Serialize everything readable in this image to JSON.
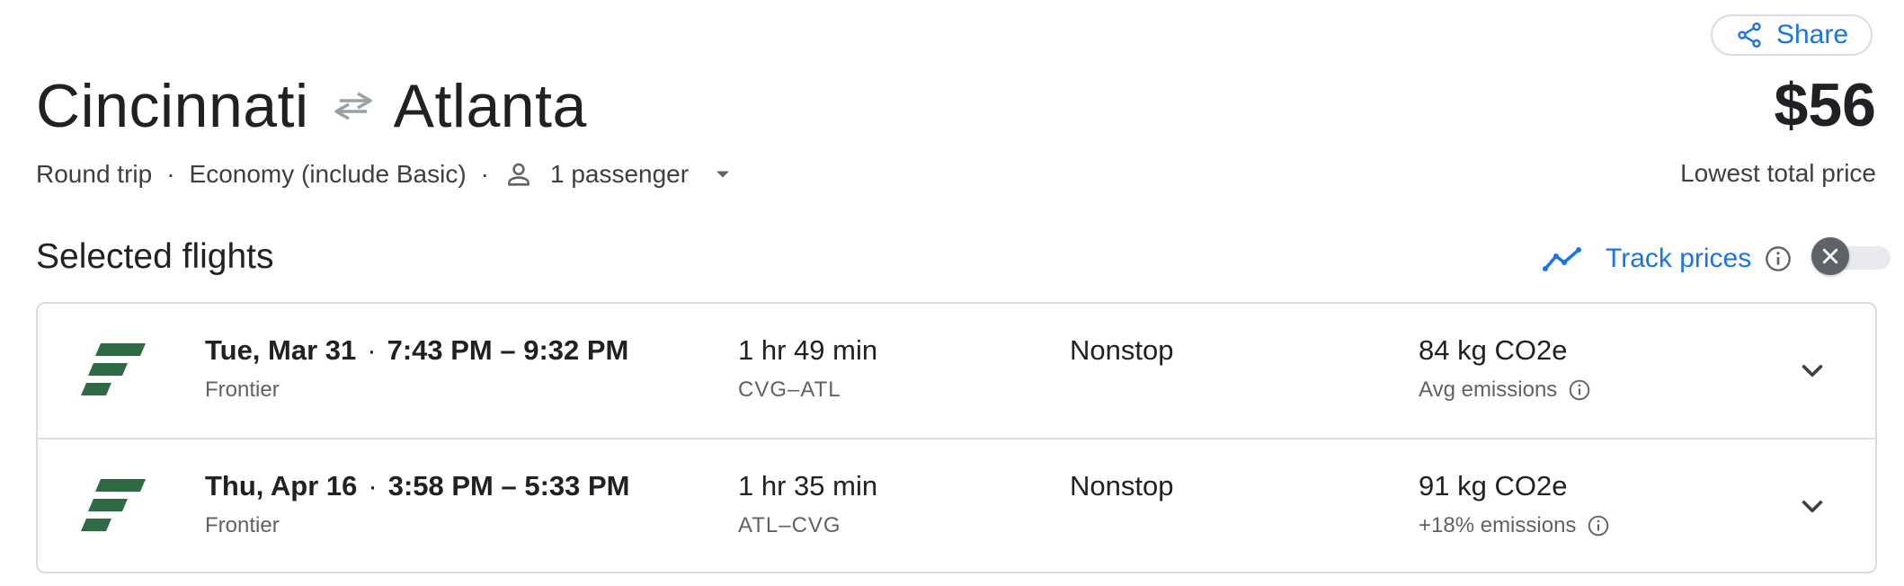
{
  "header": {
    "share_label": "Share",
    "origin": "Cincinnati",
    "destination": "Atlanta",
    "trip_type": "Round trip",
    "cabin_class": "Economy (include Basic)",
    "passengers": "1 passenger",
    "price": "$56",
    "price_label": "Lowest total price"
  },
  "selected": {
    "title": "Selected flights",
    "track_label": "Track prices",
    "track_enabled": false
  },
  "flights": [
    {
      "date": "Tue, Mar 31",
      "times": "7:43 PM – 9:32 PM",
      "airline": "Frontier",
      "duration": "1 hr 49 min",
      "airports": "CVG–ATL",
      "stops": "Nonstop",
      "co2": "84 kg CO2e",
      "emissions_note": "Avg emissions"
    },
    {
      "date": "Thu, Apr 16",
      "times": "3:58 PM – 5:33 PM",
      "airline": "Frontier",
      "duration": "1 hr 35 min",
      "airports": "ATL–CVG",
      "stops": "Nonstop",
      "co2": "91 kg CO2e",
      "emissions_note": "+18% emissions"
    }
  ],
  "icons": {
    "share": "share-icon",
    "swap": "swap-arrows-icon",
    "person": "person-icon",
    "caret": "caret-down-icon",
    "trend": "trend-line-icon",
    "info": "info-icon",
    "close": "close-icon",
    "airline_logo": "frontier-logo",
    "chevron": "chevron-down-icon"
  },
  "colors": {
    "accent": "#1a73e8",
    "frontier_green": "#2e6b45",
    "border": "#dadce0",
    "toggle_knob": "#5f6368"
  }
}
